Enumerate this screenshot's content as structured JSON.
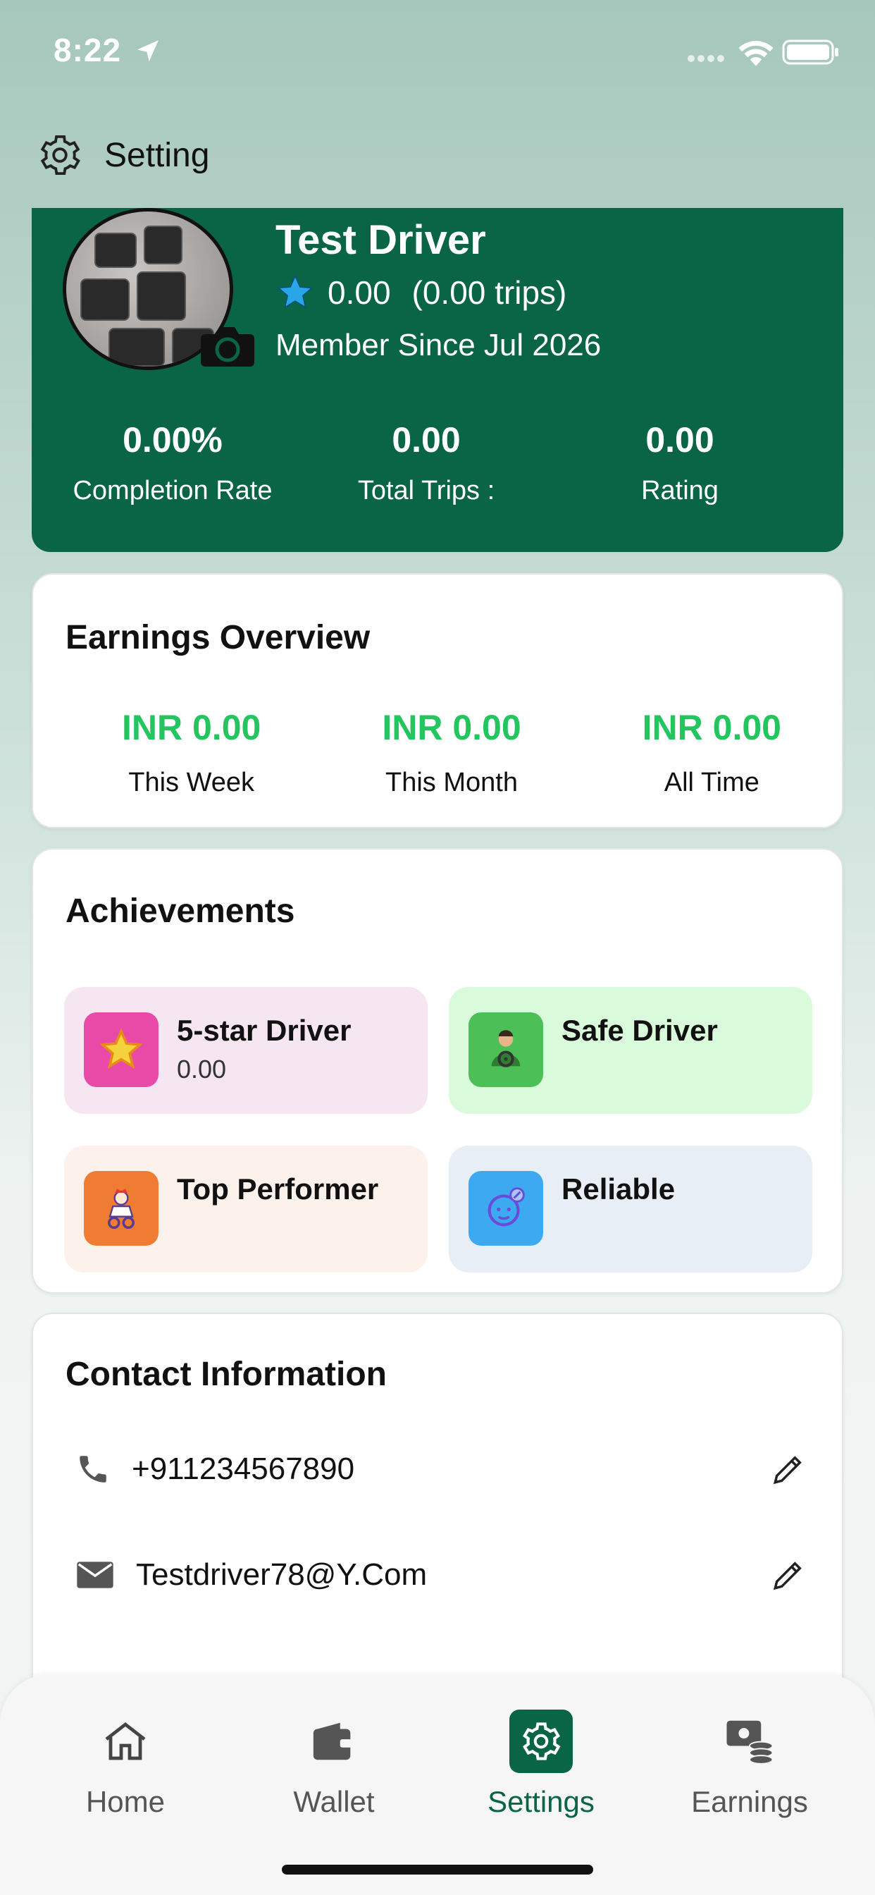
{
  "status_bar": {
    "time": "8:22"
  },
  "header": {
    "title": "Setting",
    "icon": "gear-icon"
  },
  "profile": {
    "name": "Test Driver",
    "rating": "0.00",
    "trips": "(0.00 trips)",
    "member_since": "Member Since Jul 2026",
    "stats": [
      {
        "value": "0.00%",
        "label": "Completion Rate"
      },
      {
        "value": "0.00",
        "label": "Total Trips :"
      },
      {
        "value": "0.00",
        "label": "Rating"
      }
    ]
  },
  "earnings": {
    "title": "Earnings Overview",
    "items": [
      {
        "value": "INR 0.00",
        "label": "This Week"
      },
      {
        "value": "INR 0.00",
        "label": "This Month"
      },
      {
        "value": "INR 0.00",
        "label": "All Time"
      }
    ]
  },
  "achievements": {
    "title": "Achievements",
    "items": [
      {
        "name": "5-star Driver",
        "sub": "0.00",
        "icon": "star-icon",
        "bg": "#f5e6f1",
        "icon_bg": "#e94aa8"
      },
      {
        "name": "Safe Driver",
        "sub": "",
        "icon": "driver-icon",
        "bg": "#d9fbdc",
        "icon_bg": "#4cbf57"
      },
      {
        "name": "Top Performer",
        "sub": "",
        "icon": "performer-icon",
        "bg": "#fdf1ec",
        "icon_bg": "#f07c34"
      },
      {
        "name": "Reliable",
        "sub": "",
        "icon": "reliable-icon",
        "bg": "#e7eef5",
        "icon_bg": "#3da9f0"
      }
    ]
  },
  "contact": {
    "title": "Contact Information",
    "phone": "+911234567890",
    "email": "Testdriver78@Y.Com"
  },
  "nav": {
    "items": [
      {
        "label": "Home",
        "icon": "home-icon"
      },
      {
        "label": "Wallet",
        "icon": "wallet-icon"
      },
      {
        "label": "Settings",
        "icon": "gear-icon",
        "active": true
      },
      {
        "label": "Earnings",
        "icon": "earnings-icon"
      }
    ]
  },
  "colors": {
    "brand_green": "#0a6446",
    "earnings_green": "#22c55e"
  }
}
